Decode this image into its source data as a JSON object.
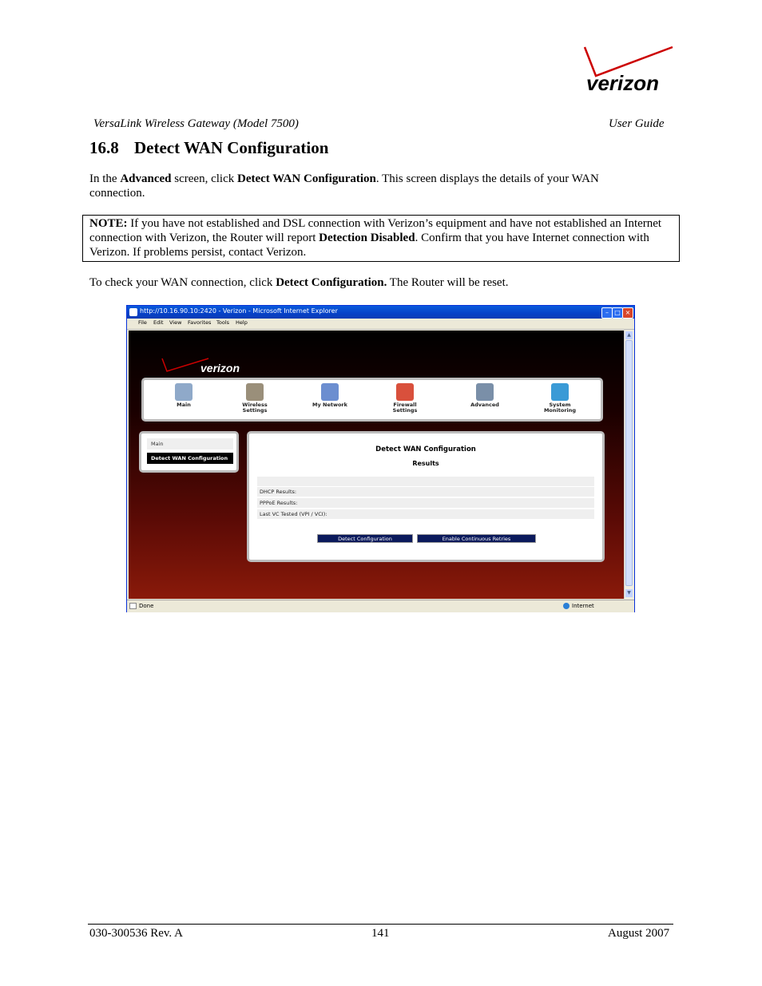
{
  "brand": {
    "logo_text": "verizon",
    "accent": "#cc0000"
  },
  "header": {
    "left": "VersaLink Wireless Gateway (Model 7500)",
    "right": "User Guide"
  },
  "section": {
    "number": "16.8",
    "title": "Detect WAN Configuration"
  },
  "para1": {
    "t1": "In the ",
    "b1": "Advanced",
    "t2": " screen, click ",
    "b2": "Detect WAN Configuration",
    "t3": ". This screen displays the details of your WAN connection."
  },
  "note": {
    "label": "NOTE:",
    "t1": " If you have not established and DSL connection with Verizon’s equipment and have not established an Internet connection with Verizon, the Router will report ",
    "b1": "Detection Disabled",
    "t2": ". Confirm that you have Internet connection with Verizon. If problems persist, contact Verizon."
  },
  "para2": {
    "t1": "To check your WAN connection, click ",
    "b1": "Detect Configuration.",
    "t2": " The Router will be reset."
  },
  "browser": {
    "title": "http://10.16.90.10:2420 - Verizon - Microsoft Internet Explorer",
    "menu": [
      "File",
      "Edit",
      "View",
      "Favorites",
      "Tools",
      "Help"
    ],
    "status_left": "Done",
    "status_right": "Internet"
  },
  "router": {
    "nav": [
      {
        "label": "Main",
        "icon": "main-icon",
        "color": "#8fa9c9"
      },
      {
        "label": "Wireless\nSettings",
        "icon": "wireless-icon",
        "color": "#9a8f7a"
      },
      {
        "label": "My Network",
        "icon": "network-icon",
        "color": "#6c8ed0"
      },
      {
        "label": "Firewall\nSettings",
        "icon": "firewall-icon",
        "color": "#d9503c"
      },
      {
        "label": "Advanced",
        "icon": "advanced-icon",
        "color": "#7a8fa8"
      },
      {
        "label": "System\nMonitoring",
        "icon": "monitor-icon",
        "color": "#3a9ad6"
      }
    ],
    "side": {
      "main": "Main",
      "active": "Detect WAN Configuration"
    },
    "panel": {
      "title": "Detect WAN Configuration",
      "subtitle": "Results",
      "rows": [
        "",
        "DHCP Results:",
        "PPPoE Results:",
        "Last VC Tested (VPI / VCI):"
      ],
      "btn_detect": "Detect Configuration",
      "btn_retry": "Enable Continuous Retries"
    }
  },
  "footer": {
    "left": "030-300536 Rev. A",
    "center": "141",
    "right": "August 2007"
  }
}
